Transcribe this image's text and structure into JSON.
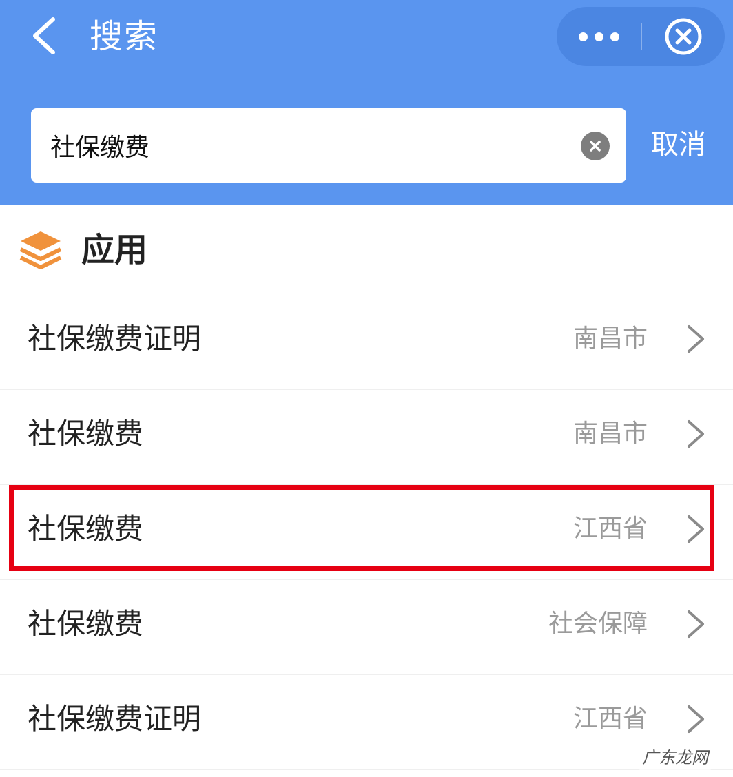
{
  "header": {
    "title": "搜索",
    "back_icon": "chevron-left-icon",
    "more_icon": "more-dots-icon",
    "close_icon": "close-circle-icon",
    "background_color": "#5a95ef"
  },
  "search": {
    "value": "社保缴费",
    "clear_icon": "clear-icon",
    "cancel_label": "取消"
  },
  "section": {
    "icon": "layers-icon",
    "icon_color": "#f0923c",
    "title": "应用"
  },
  "results": [
    {
      "title": "社保缴费证明",
      "region": "南昌市",
      "highlighted": false
    },
    {
      "title": "社保缴费",
      "region": "南昌市",
      "highlighted": false
    },
    {
      "title": "社保缴费",
      "region": "江西省",
      "highlighted": true
    },
    {
      "title": "社保缴费",
      "region": "社会保障",
      "highlighted": false
    },
    {
      "title": "社保缴费证明",
      "region": "江西省",
      "highlighted": false
    }
  ],
  "highlight_color": "#e60012",
  "watermark": "广东龙网"
}
